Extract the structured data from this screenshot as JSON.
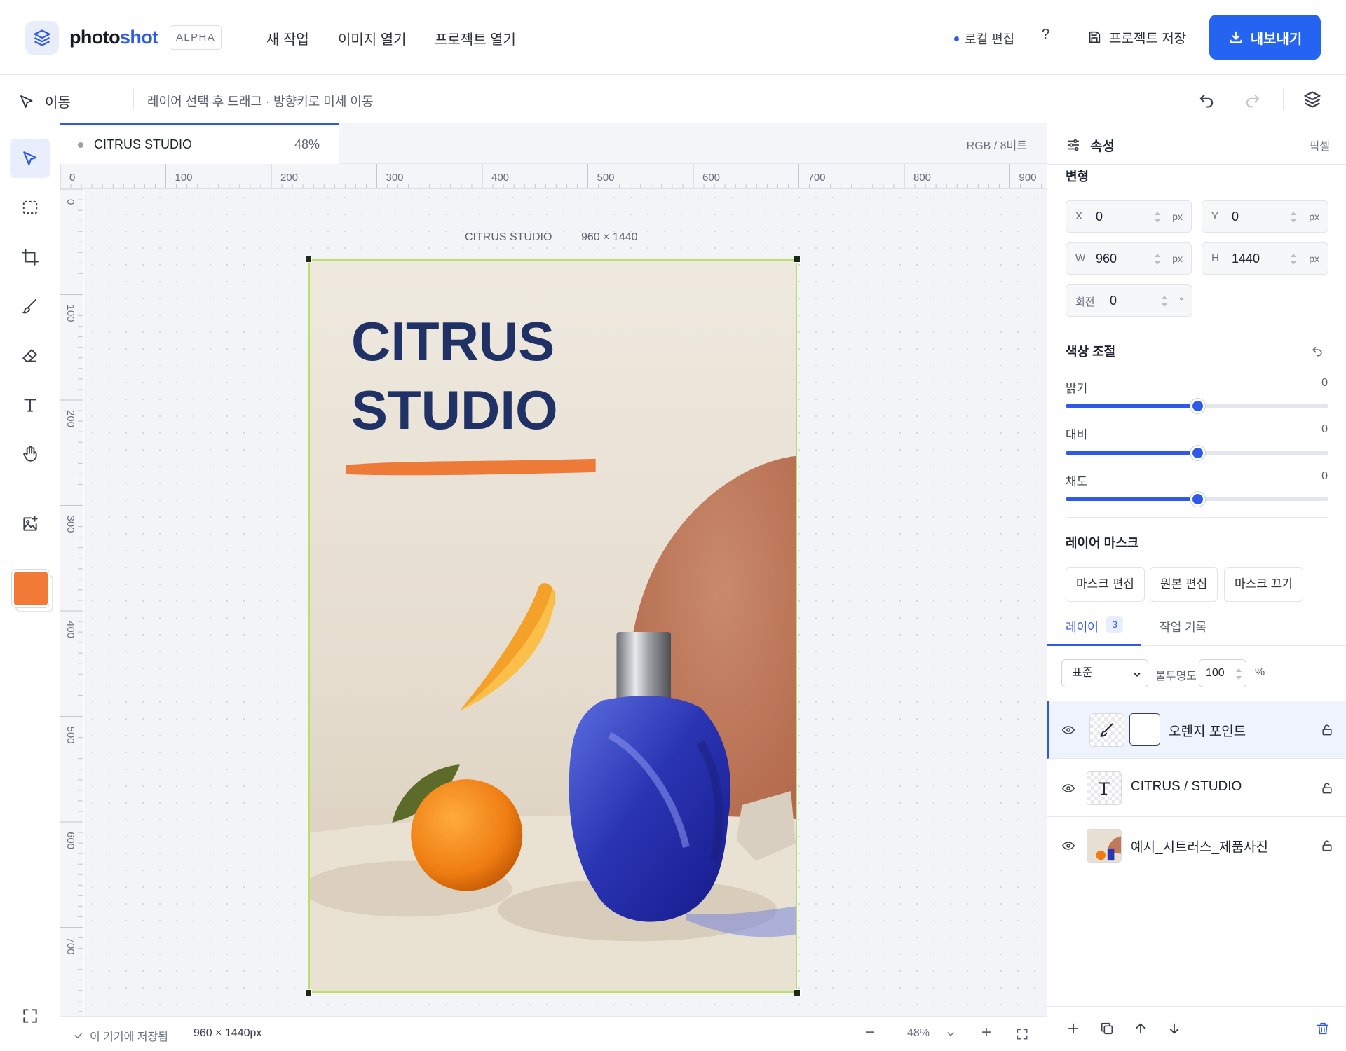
{
  "app": {
    "name_part1": "photo",
    "name_part2": "shot",
    "badge": "ALPHA",
    "menu": [
      "새 작업",
      "이미지 열기",
      "프로젝트 열기"
    ],
    "local_edit": "로컬 편집",
    "help": "?",
    "save_label": "프로젝트 저장",
    "export_label": "내보내기",
    "accent_color": "#2464f0"
  },
  "tool_options": {
    "tool_name": "이동",
    "hint": "레이어 선택 후 드래그 · 방향키로 미세 이동"
  },
  "toolbar": {
    "tools": [
      "move-tool",
      "marquee-tool",
      "crop-tool",
      "brush-tool",
      "eraser-tool",
      "text-tool",
      "hand-tool",
      "add-image-tool"
    ],
    "active_tool": "move-tool",
    "foreground_color": "#f07a36"
  },
  "document": {
    "tab_name": "CITRUS STUDIO",
    "tab_zoom": "48%",
    "color_mode": "RGB / 8비트",
    "artboard_name": "CITRUS STUDIO",
    "artboard_size": "960 × 1440",
    "art_title_line1": "CITRUS",
    "art_title_line2": "STUDIO",
    "ruler_top": [
      "0",
      "100",
      "200",
      "300",
      "400",
      "500",
      "600",
      "700",
      "800",
      "900"
    ],
    "ruler_left": [
      "0",
      "100",
      "200",
      "300",
      "400",
      "500",
      "600",
      "700"
    ]
  },
  "status": {
    "saved": "이 기기에 저장됨",
    "size": "960 × 1440px",
    "zoom": "48%"
  },
  "properties": {
    "title": "속성",
    "unit": "픽셀",
    "transform_title": "변형",
    "x": {
      "label": "X",
      "value": "0",
      "unit": "px"
    },
    "y": {
      "label": "Y",
      "value": "0",
      "unit": "px"
    },
    "w": {
      "label": "W",
      "value": "960",
      "unit": "px"
    },
    "h": {
      "label": "H",
      "value": "1440",
      "unit": "px"
    },
    "rotation": {
      "label": "회전",
      "value": "0",
      "unit": "°"
    },
    "color_adjust_title": "색상 조절",
    "sliders": [
      {
        "label": "밝기",
        "value": "0",
        "fraction": 0.5
      },
      {
        "label": "대비",
        "value": "0",
        "fraction": 0.5
      },
      {
        "label": "채도",
        "value": "0",
        "fraction": 0.5
      }
    ],
    "mask_title": "레이어 마스크",
    "mask_buttons": [
      "마스크 편집",
      "원본 편집",
      "마스크 끄기"
    ]
  },
  "layers_panel": {
    "tab_layers": "레이어",
    "layer_count": "3",
    "tab_history": "작업 기록",
    "blend_mode": "표준",
    "opacity_label": "불투명도",
    "opacity_value": "100",
    "opacity_unit": "%",
    "layers": [
      {
        "name": "오렌지 포인트",
        "type": "brush",
        "selected": true
      },
      {
        "name": "CITRUS / STUDIO",
        "type": "text",
        "selected": false
      },
      {
        "name": "예시_시트러스_제품사진",
        "type": "image",
        "selected": false
      }
    ]
  }
}
